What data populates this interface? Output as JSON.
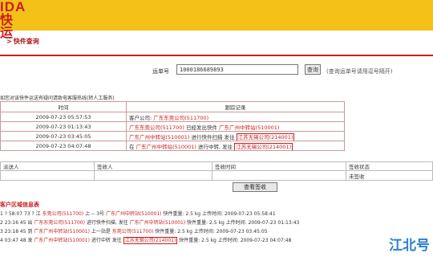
{
  "header": {
    "logo_line1": "IDA",
    "logo_line2": "快运",
    "accent": "#f3c117",
    "brand_red": "#c81e1e"
  },
  "breadcrumb": {
    "arrow": ">",
    "label": "快件查询"
  },
  "search": {
    "label": "运单号",
    "value": "1000186689893",
    "button": "查询",
    "note": "(查询运单号请用逗号隔开)"
  },
  "notice": "如您对该快件运送有疑问请致电客服热线(转人工服务)",
  "track": {
    "headers": [
      "时间",
      "跟踪记录"
    ],
    "rows": [
      {
        "time": "2009-07-23 05:57:53",
        "desc": [
          {
            "t": "客户公司: "
          },
          {
            "t": "广东东莞公司(511700)",
            "s": "hl"
          }
        ]
      },
      {
        "time": "2009-07-23 01:13:43",
        "desc": [
          {
            "t": "广东东莞公司(511700)",
            "s": "hl"
          },
          {
            "t": " 已经发出快件 "
          },
          {
            "t": "广东广州中转站(510001)",
            "s": "hl"
          }
        ]
      },
      {
        "time": "2009-07-23 03:45:05",
        "desc": [
          {
            "t": "广东广州中转站(510001)",
            "s": "hl"
          },
          {
            "t": " 进行快件扫描 发往 "
          },
          {
            "t": "江苏无锡公司(214001)",
            "s": "hlbox"
          }
        ]
      },
      {
        "time": "2009-07-23 04:07:48",
        "desc": [
          {
            "t": "在 "
          },
          {
            "t": "广东广州中转站(510001)",
            "s": "hl"
          },
          {
            "t": " 进行中转, 发往 "
          },
          {
            "t": "江苏无锡公司(214001)",
            "s": "hlbox"
          }
        ]
      }
    ]
  },
  "sign": {
    "headers": [
      "派送人",
      "签收人",
      "签收时间",
      "签收状态"
    ],
    "status": "未签收"
  },
  "confirm": "查看签收",
  "list": {
    "title": "客户区域信息表",
    "rows": [
      [
        {
          "t": "1 ? 58:07 73 ? 江 "
        },
        {
          "t": "东莞公司(511700)",
          "s": "hl"
        },
        {
          "t": " 上 -- 3号 "
        },
        {
          "t": "广东广州中转站(510001)",
          "s": "hl"
        },
        {
          "t": " 快件重量: 2.5 kg 上传时间: 2009-07-23 05:58:41"
        }
      ],
      [
        {
          "t": "2 23:16 45 出 "
        },
        {
          "t": "广东东莞公司(511700)",
          "s": "hl"
        },
        {
          "t": " 进行快件扫描, 发往 "
        },
        {
          "t": "广东广州中转站(510001)",
          "s": "hl"
        },
        {
          "t": " 快件重量: 2.5 kg 上传时间: 2009-07-23 01:13:43"
        }
      ],
      [
        {
          "t": "3 23:18 45 到 "
        },
        {
          "t": "广东广州中转站(510001)",
          "s": "hl"
        },
        {
          "t": " 上一站是 "
        },
        {
          "t": "东莞公司(511700)",
          "s": "hl"
        },
        {
          "t": " 快件重量: 2.5 kg 上传时间: 2009-07-23 03:45:05"
        }
      ],
      [
        {
          "t": "4 03:47 48 发 "
        },
        {
          "t": "广东广州中转站(510001)",
          "s": "hl"
        },
        {
          "t": " 进行中转 发往 "
        },
        {
          "t": "江苏无锡公司(214001)",
          "s": "hlbox"
        },
        {
          "t": " 快件重量: 2.5 kg 上传时间: 2009-07-23 04:07:48"
        }
      ]
    ]
  },
  "watermark": "江北号"
}
